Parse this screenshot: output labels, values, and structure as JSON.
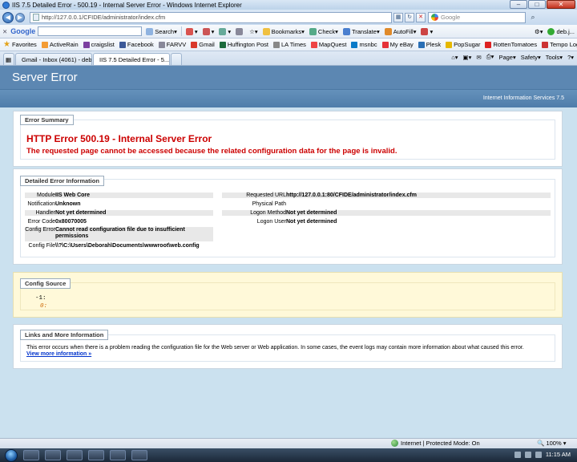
{
  "window": {
    "title": "IIS 7.5 Detailed Error - 500.19 - Internal Server Error - Windows Internet Explorer"
  },
  "address_bar": {
    "url": "http://127.0.0.1/CFIDE/administrator/index.cfm",
    "search_placeholder": "Google"
  },
  "google_toolbar": {
    "logo": "Google",
    "items": [
      "Search",
      "Bookmarks",
      "Check",
      "Translate",
      "AutoFill",
      "deb.j..."
    ]
  },
  "favorites": {
    "label": "Favorites",
    "items": [
      "ActiveRain",
      "craigslist",
      "Facebook",
      "FARVV",
      "Gmail",
      "Huffington Post",
      "LA Times",
      "MapQuest",
      "msnbc",
      "My eBay",
      "Plesk",
      "PopSugar",
      "RottenTomatoes",
      "Tempo Login"
    ]
  },
  "tabs": [
    {
      "label": "Gmail - Inbox (4061) - deb..."
    },
    {
      "label": "IIS 7.5 Detailed Error - 5..."
    }
  ],
  "command_bar": {
    "page": "Page",
    "safety": "Safety",
    "tools": "Tools"
  },
  "page": {
    "header": "Server Error",
    "subheader": "Internet Information Services 7.5",
    "summary": {
      "title": "Error Summary",
      "error_title": "HTTP Error 500.19 - Internal Server Error",
      "error_message": "The requested page cannot be accessed because the related configuration data for the page is invalid."
    },
    "details": {
      "title": "Detailed Error Information",
      "left": [
        {
          "k": "Module",
          "v": "IIS Web Core"
        },
        {
          "k": "Notification",
          "v": "Unknown"
        },
        {
          "k": "Handler",
          "v": "Not yet determined"
        },
        {
          "k": "Error Code",
          "v": "0x80070005"
        },
        {
          "k": "Config Error",
          "v": "Cannot read configuration file due to insufficient permissions"
        },
        {
          "k": "Config File",
          "v": "\\\\?\\C:\\Users\\Deborah\\Documents\\wwwroot\\web.config"
        }
      ],
      "right": [
        {
          "k": "Requested URL",
          "v": "http://127.0.0.1:80/CFIDE/administrator/index.cfm"
        },
        {
          "k": "Physical Path",
          "v": ""
        },
        {
          "k": "Logon Method",
          "v": "Not yet determined"
        },
        {
          "k": "Logon User",
          "v": "Not yet determined"
        }
      ]
    },
    "config_source": {
      "title": "Config Source",
      "lines": [
        "-1:",
        "0:"
      ]
    },
    "links": {
      "title": "Links and More Information",
      "text": "This error occurs when there is a problem reading the configuration file for the Web server or Web application. In some cases, the event logs may contain more information about what caused this error.",
      "more": "View more information »"
    }
  },
  "status_bar": {
    "zone": "Internet | Protected Mode: On",
    "zoom": "100%"
  },
  "taskbar": {
    "time": "11:15 AM"
  }
}
